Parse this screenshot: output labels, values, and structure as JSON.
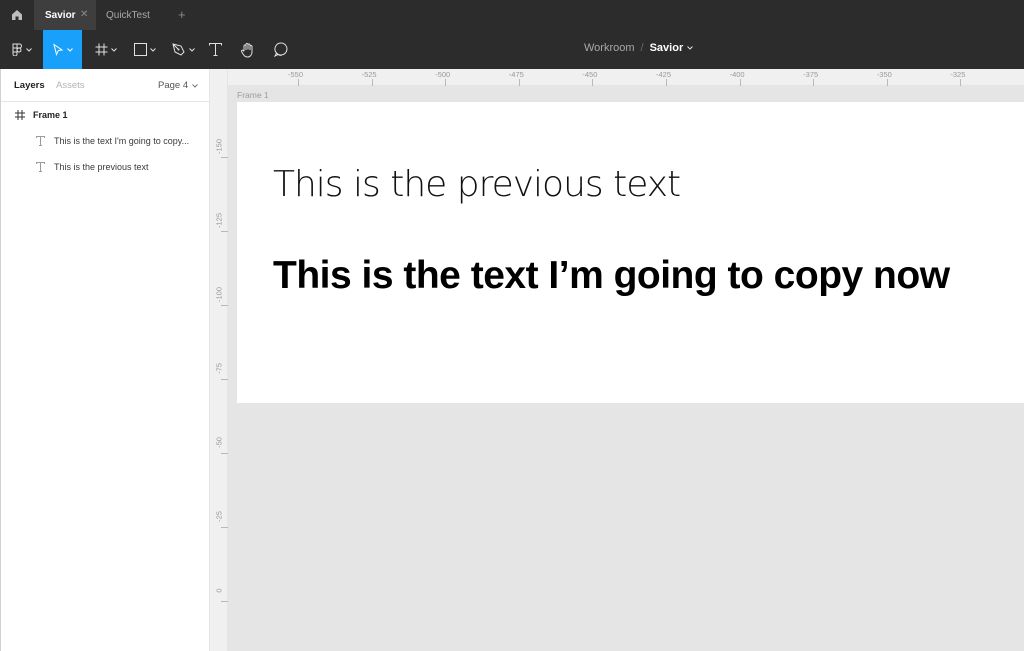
{
  "tabs": {
    "home_icon": "home-icon",
    "active": {
      "label": "Savior"
    },
    "inactive": {
      "label": "QuickTest"
    },
    "add_icon": "plus-icon"
  },
  "toolbar": {
    "tools": [
      "main-menu-icon",
      "move-tool-icon",
      "frame-tool-icon",
      "rectangle-tool-icon",
      "pen-tool-icon",
      "text-tool-icon",
      "hand-tool-icon",
      "comment-tool-icon"
    ],
    "accent": "#18a0fb"
  },
  "breadcrumb": {
    "team": "Workroom",
    "separator": "/",
    "file": "Savior"
  },
  "left_panel": {
    "tabs": {
      "layers": "Layers",
      "assets": "Assets",
      "page": "Page 4"
    },
    "layers": [
      {
        "name": "Frame 1",
        "type": "frame"
      },
      {
        "name": "This is the text I'm going to copy...",
        "type": "text"
      },
      {
        "name": "This is the previous text",
        "type": "text"
      }
    ]
  },
  "rulers": {
    "top": [
      "-550",
      "-525",
      "-500",
      "-475",
      "-450",
      "-425",
      "-400",
      "-375",
      "-350",
      "-325"
    ],
    "left": [
      "-150",
      "-125",
      "-100",
      "-75",
      "-50",
      "-25",
      "0"
    ]
  },
  "canvas": {
    "frame_label": "Frame 1",
    "text_previous": "This is the previous text",
    "text_copy": "This is the text I’m going to copy now"
  }
}
